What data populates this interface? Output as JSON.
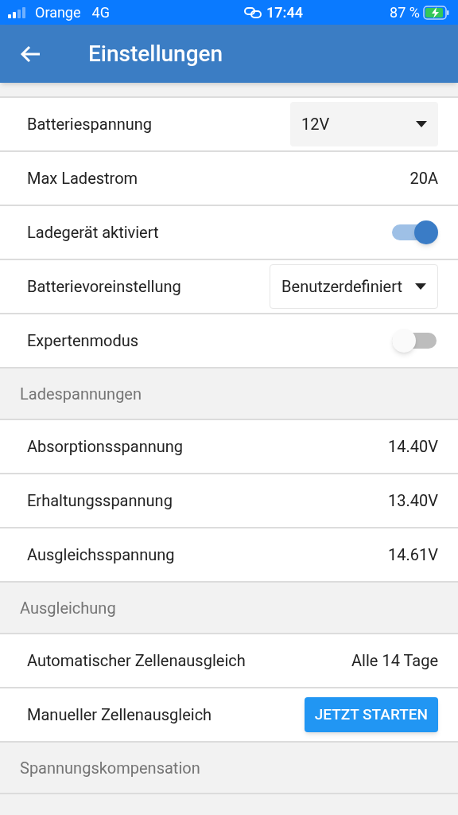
{
  "status_bar": {
    "carrier": "Orange",
    "network": "4G",
    "time": "17:44",
    "battery": "87 %"
  },
  "header": {
    "title": "Einstellungen"
  },
  "sections": [
    {
      "rows": [
        {
          "kind": "select",
          "label": "Batteriespannung",
          "value": "12V",
          "filled": true
        },
        {
          "kind": "value",
          "label": "Max Ladestrom",
          "value": "20A"
        },
        {
          "kind": "toggle",
          "label": "Ladegerät aktiviert",
          "on": true
        },
        {
          "kind": "select",
          "label": "Batterievoreinstellung",
          "value": "Benutzerdefiniert",
          "filled": false
        },
        {
          "kind": "toggle",
          "label": "Expertenmodus",
          "on": false
        }
      ]
    },
    {
      "title": "Ladespannungen",
      "rows": [
        {
          "kind": "value",
          "label": "Absorptionsspannung",
          "value": "14.40V"
        },
        {
          "kind": "value",
          "label": "Erhaltungsspannung",
          "value": "13.40V"
        },
        {
          "kind": "value",
          "label": "Ausgleichsspannung",
          "value": "14.61V"
        }
      ]
    },
    {
      "title": "Ausgleichung",
      "rows": [
        {
          "kind": "value",
          "label": "Automatischer Zellenausgleich",
          "value": "Alle 14 Tage"
        },
        {
          "kind": "button",
          "label": "Manueller Zellenausgleich",
          "value": "JETZT STARTEN"
        }
      ]
    },
    {
      "title": "Spannungskompensation"
    }
  ]
}
